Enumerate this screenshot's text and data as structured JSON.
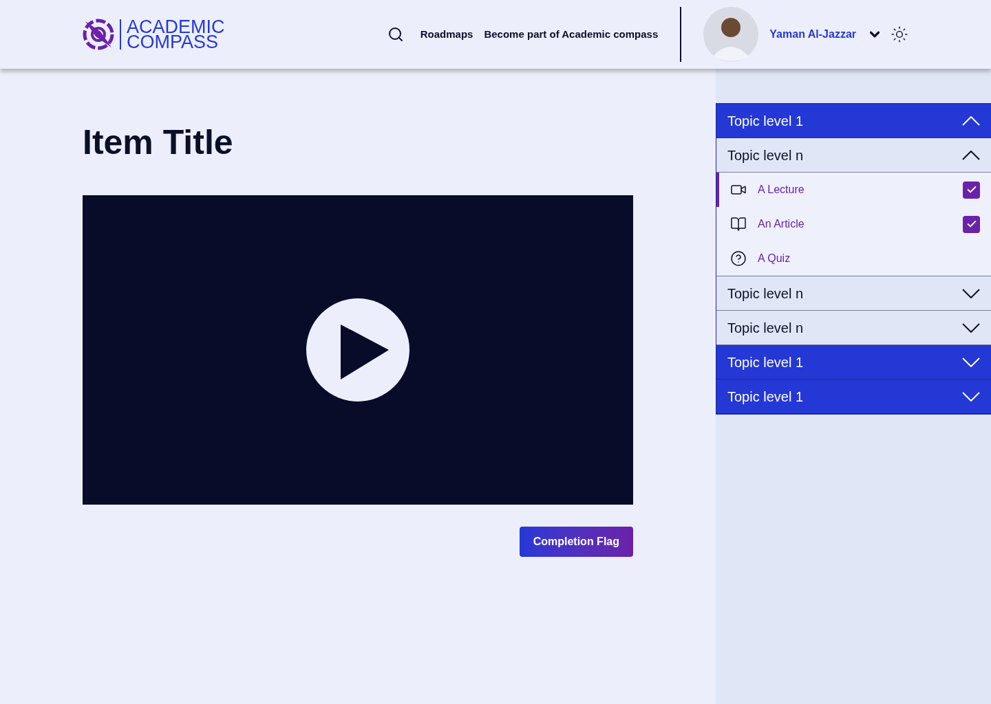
{
  "header": {
    "logo": {
      "line1": "ACADEMIC",
      "line2": "COMPASS"
    },
    "nav": [
      "Roadmaps",
      "Become part of Academic compass"
    ],
    "user": {
      "name": "Yaman Al-Jazzar"
    }
  },
  "main": {
    "title": "Item Title",
    "button": "Completion Flag"
  },
  "sidebar": {
    "topics": [
      {
        "label": "Topic level 1",
        "expanded": true,
        "children": [
          {
            "label": "Topic level n",
            "expanded": true,
            "items": [
              {
                "kind": "video",
                "label": "A Lecture",
                "checked": true,
                "selected": true
              },
              {
                "kind": "article",
                "label": "An Article",
                "checked": true,
                "selected": false
              },
              {
                "kind": "quiz",
                "label": "A Quiz",
                "checked": false,
                "selected": false
              }
            ]
          },
          {
            "label": "Topic level n",
            "expanded": false
          },
          {
            "label": "Topic level n",
            "expanded": false
          }
        ]
      },
      {
        "label": "Topic level 1",
        "expanded": false
      },
      {
        "label": "Topic level 1",
        "expanded": false
      }
    ]
  }
}
